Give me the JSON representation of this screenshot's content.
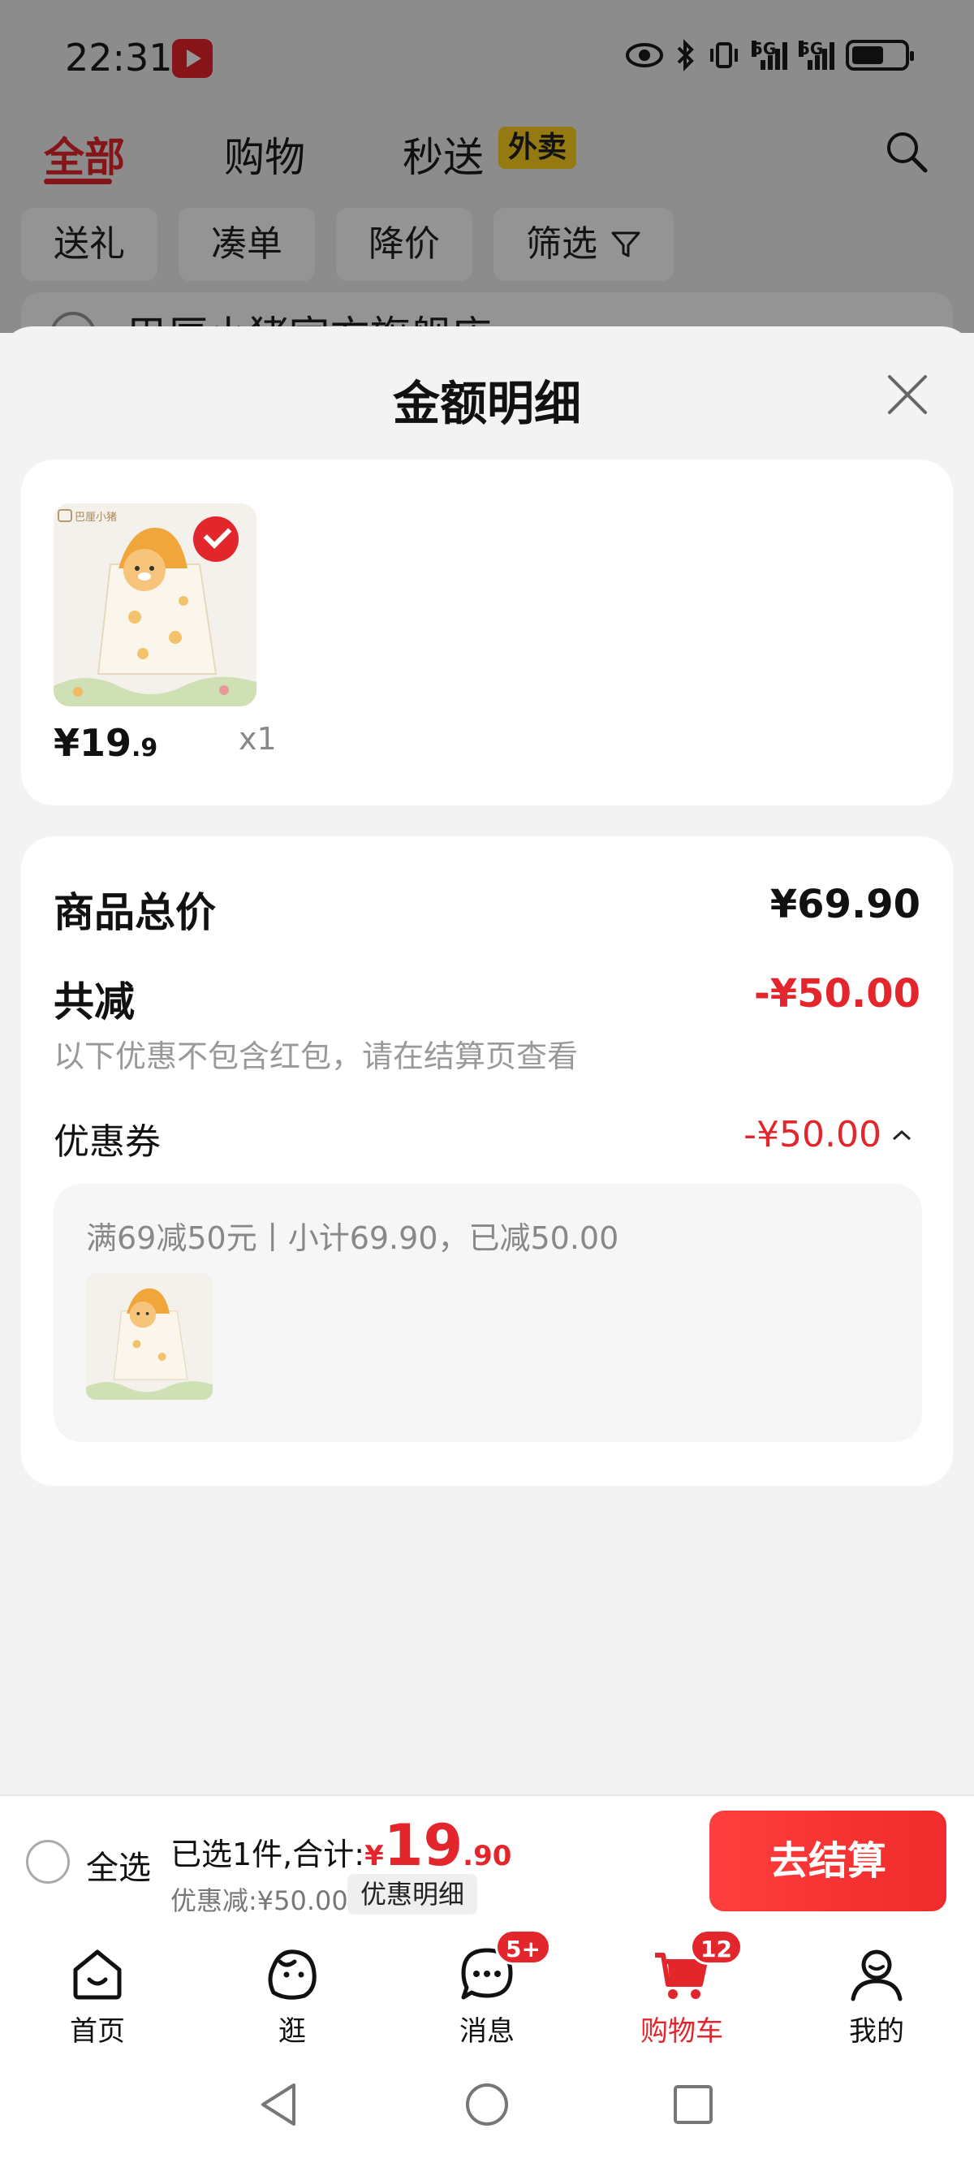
{
  "status_bar": {
    "time": "22:31",
    "network_1": "5G",
    "network_2": "5G"
  },
  "top_tabs": [
    {
      "label": "全部",
      "active": true
    },
    {
      "label": "购物",
      "active": false
    },
    {
      "label": "秒送",
      "active": false
    }
  ],
  "waimai_badge": "外卖",
  "filters": [
    "送礼",
    "凑单",
    "降价",
    "筛选"
  ],
  "background_store": "巴厘小猪官方旗舰店",
  "sheet": {
    "title": "金额明细",
    "product": {
      "price_yen": "¥19",
      "price_cents": ".9",
      "quantity": "x1",
      "image_brand": "巴厘小猪"
    },
    "summary": {
      "total_label": "商品总价",
      "total_value": "¥69.90",
      "reduce_label": "共减",
      "reduce_value": "-¥50.00",
      "reduce_note": "以下优惠不包含红包，请在结算页查看",
      "coupon_label": "优惠券",
      "coupon_value": "-¥50.00",
      "coupon_desc": "满69减50元丨小计69.90，已减50.00"
    }
  },
  "checkout": {
    "select_all": "全选",
    "selected_prefix": "已选1件,合计:",
    "price_yen": "¥",
    "price_int": "19",
    "price_cents": ".90",
    "discount": "优惠减:¥50.00",
    "detail_button": "优惠明细",
    "checkout_button": "去结算"
  },
  "bottom_nav": [
    {
      "label": "首页",
      "icon": "home-icon",
      "badge": ""
    },
    {
      "label": "逛",
      "icon": "explore-icon",
      "badge": ""
    },
    {
      "label": "消息",
      "icon": "message-icon",
      "badge": "5+"
    },
    {
      "label": "购物车",
      "icon": "cart-icon",
      "badge": "12",
      "active": true
    },
    {
      "label": "我的",
      "icon": "profile-icon",
      "badge": ""
    }
  ],
  "colors": {
    "accent": "#e3262c",
    "badge_yellow": "#ffd21e"
  }
}
